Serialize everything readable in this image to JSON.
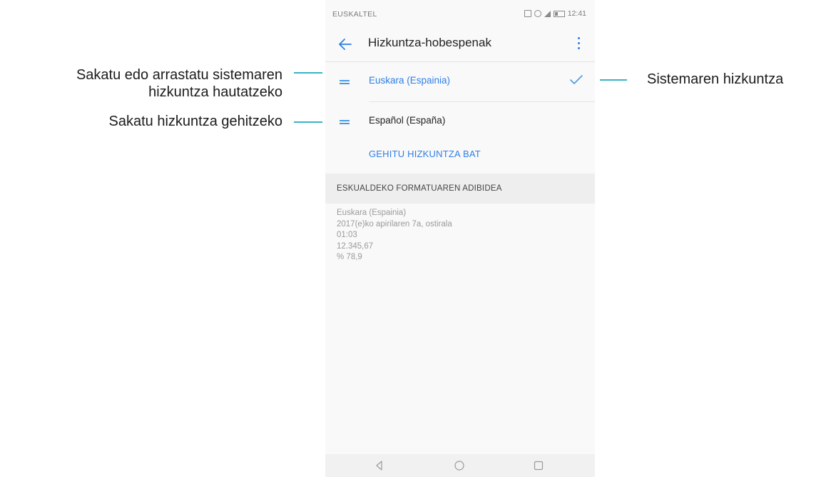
{
  "callouts": {
    "drag_select_line1": "Sakatu edo arrastatu sistemaren",
    "drag_select_line2": "hizkuntza hautatzeko",
    "add_language": "Sakatu hizkuntza gehitzeko",
    "system_language": "Sistemaren hizkuntza",
    "line_color": "#39b3c6"
  },
  "status_bar": {
    "carrier": "EUSKALTEL",
    "time": "12:41"
  },
  "app_bar": {
    "title": "Hizkuntza-hobespenak",
    "back_icon": "arrow-left-icon",
    "menu_icon": "more-vertical-icon"
  },
  "languages": [
    {
      "label": "Euskara (Espainia)",
      "selected": true,
      "color": "#2f7fe6"
    },
    {
      "label": "Español (España)",
      "selected": false,
      "color": "#222222"
    }
  ],
  "add_language_label": "GEHITU HIZKUNTZA BAT",
  "format_section": {
    "header": "ESKUALDEKO FORMATUAREN ADIBIDEA",
    "lines": [
      "Euskara (Espainia)",
      "2017(e)ko apirilaren 7a, ostirala",
      "01:03",
      "12.345,67",
      "% 78,9"
    ]
  },
  "nav_bar": {
    "back_icon": "triangle-back-icon",
    "home_icon": "circle-home-icon",
    "recents_icon": "square-recents-icon"
  },
  "accent_color": "#2f7fe6"
}
